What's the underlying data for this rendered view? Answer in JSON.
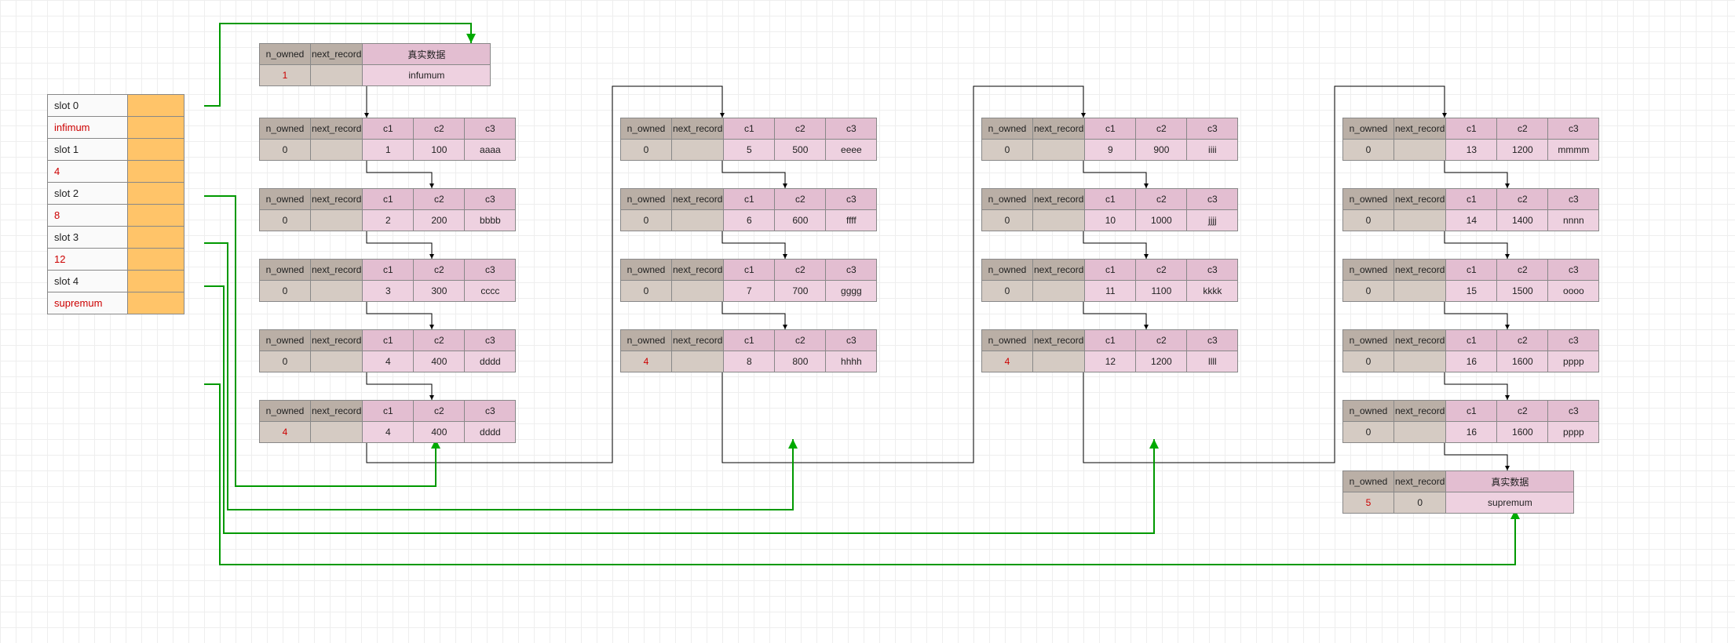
{
  "headers": {
    "n_owned": "n_owned",
    "next_record": "next_record",
    "real_data": "真实数据",
    "c1": "c1",
    "c2": "c2",
    "c3": "c3"
  },
  "slots": [
    {
      "label": "slot 0",
      "value": "infimum"
    },
    {
      "label": "slot 1",
      "value": "4"
    },
    {
      "label": "slot 2",
      "value": "8"
    },
    {
      "label": "slot 3",
      "value": "12"
    },
    {
      "label": "slot 4",
      "value": "supremum"
    }
  ],
  "special": {
    "infumum": {
      "n_owned": "1",
      "data": "infumum"
    },
    "supremum": {
      "n_owned": "5",
      "next_record": "0",
      "data": "supremum"
    }
  },
  "records": {
    "0": {
      "n_owned": "0",
      "c1": "1",
      "c2": "100",
      "c3": "aaaa"
    },
    "1": {
      "n_owned": "0",
      "c1": "2",
      "c2": "200",
      "c3": "bbbb"
    },
    "2": {
      "n_owned": "0",
      "c1": "3",
      "c2": "300",
      "c3": "cccc"
    },
    "3": {
      "n_owned": "0",
      "c1": "4",
      "c2": "400",
      "c3": "dddd"
    },
    "3b": {
      "n_owned": "4",
      "c1": "4",
      "c2": "400",
      "c3": "dddd"
    },
    "4": {
      "n_owned": "0",
      "c1": "5",
      "c2": "500",
      "c3": "eeee"
    },
    "5": {
      "n_owned": "0",
      "c1": "6",
      "c2": "600",
      "c3": "ffff"
    },
    "6": {
      "n_owned": "0",
      "c1": "7",
      "c2": "700",
      "c3": "gggg"
    },
    "7": {
      "n_owned": "4",
      "c1": "8",
      "c2": "800",
      "c3": "hhhh"
    },
    "8": {
      "n_owned": "0",
      "c1": "9",
      "c2": "900",
      "c3": "iiii"
    },
    "9": {
      "n_owned": "0",
      "c1": "10",
      "c2": "1000",
      "c3": "jjjj"
    },
    "10": {
      "n_owned": "0",
      "c1": "11",
      "c2": "1100",
      "c3": "kkkk"
    },
    "11": {
      "n_owned": "4",
      "c1": "12",
      "c2": "1200",
      "c3": "llll"
    },
    "12": {
      "n_owned": "0",
      "c1": "13",
      "c2": "1200",
      "c3": "mmmm"
    },
    "13": {
      "n_owned": "0",
      "c1": "14",
      "c2": "1400",
      "c3": "nnnn"
    },
    "14": {
      "n_owned": "0",
      "c1": "15",
      "c2": "1500",
      "c3": "oooo"
    },
    "15": {
      "n_owned": "0",
      "c1": "16",
      "c2": "1600",
      "c3": "pppp"
    },
    "15b": {
      "n_owned": "0",
      "c1": "16",
      "c2": "1600",
      "c3": "pppp"
    }
  }
}
